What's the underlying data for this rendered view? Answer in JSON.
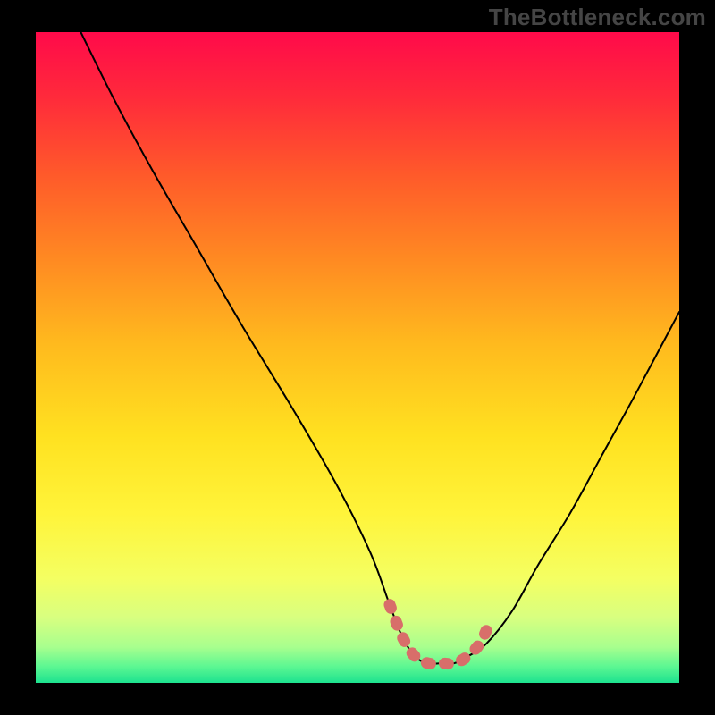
{
  "watermark": "TheBottleneck.com",
  "colors": {
    "frame": "#000000",
    "watermark_text": "#454545",
    "curve": "#000000",
    "highlight": "#d86e6a",
    "gradient_stops": [
      {
        "offset": 0.0,
        "color": "#ff0a4a"
      },
      {
        "offset": 0.1,
        "color": "#ff2a3b"
      },
      {
        "offset": 0.22,
        "color": "#ff5a2a"
      },
      {
        "offset": 0.35,
        "color": "#ff8a22"
      },
      {
        "offset": 0.48,
        "color": "#ffba1e"
      },
      {
        "offset": 0.62,
        "color": "#ffe120"
      },
      {
        "offset": 0.74,
        "color": "#fff43a"
      },
      {
        "offset": 0.84,
        "color": "#f4ff62"
      },
      {
        "offset": 0.9,
        "color": "#d8ff80"
      },
      {
        "offset": 0.945,
        "color": "#a8ff8e"
      },
      {
        "offset": 0.975,
        "color": "#5cf792"
      },
      {
        "offset": 1.0,
        "color": "#1de28f"
      }
    ]
  },
  "chart_data": {
    "type": "line",
    "title": "",
    "xlabel": "",
    "ylabel": "",
    "xlim": [
      0,
      100
    ],
    "ylim": [
      0,
      100
    ],
    "note": "No axes or tick labels are drawn. Values are estimated from pixel positions; y=0 is the bottom (green) band and y=100 is the top (red).",
    "series": [
      {
        "name": "bottleneck-curve",
        "x": [
          7,
          12,
          18,
          25,
          32,
          40,
          47,
          52,
          55,
          57,
          59,
          61,
          63,
          65,
          67,
          70,
          74,
          78,
          83,
          88,
          93,
          100
        ],
        "y": [
          100,
          90,
          79,
          67,
          55,
          42,
          30,
          20,
          12,
          7,
          4,
          3,
          3,
          3,
          4,
          6,
          11,
          18,
          26,
          35,
          44,
          57
        ]
      }
    ],
    "highlight_segment": {
      "name": "optimal-flat-region",
      "x": [
        55,
        57,
        59,
        61,
        63,
        65,
        67,
        69,
        70
      ],
      "y": [
        12,
        7,
        4,
        3,
        3,
        3,
        4,
        6,
        8
      ]
    }
  }
}
